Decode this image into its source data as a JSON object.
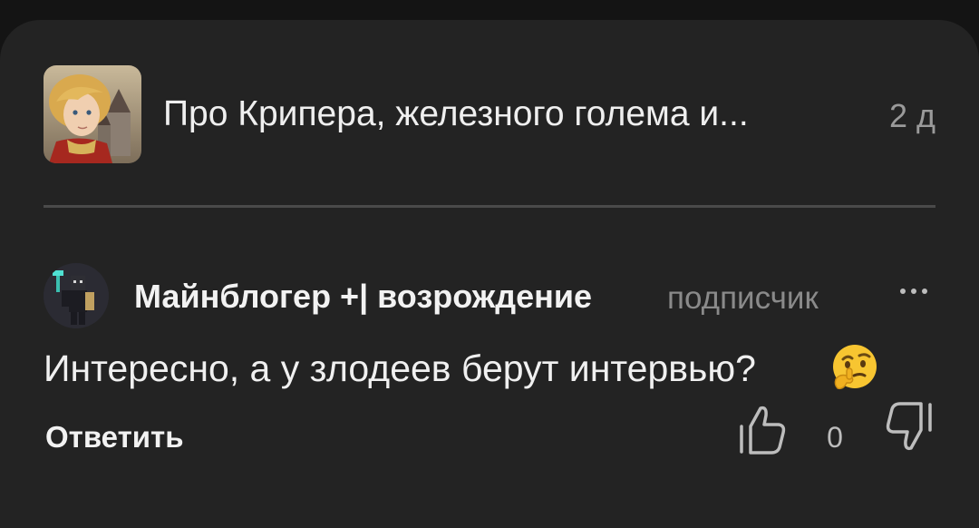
{
  "post": {
    "title": "Про Крипера, железного голема и...",
    "time": "2 д",
    "thumbnail_icon": "anime-prince-castle-icon"
  },
  "comment": {
    "author": "Майнблогер +| возрождение",
    "role": "подписчик",
    "text": "Интересно, а у злодеев берут интервью?",
    "emoji_icon": "thinking-face-emoji",
    "avatar_icon": "minecraft-character-icon",
    "more_icon": "more-horizontal-icon"
  },
  "actions": {
    "reply_label": "Ответить",
    "like_icon": "thumbs-up-icon",
    "like_count": "0",
    "dislike_icon": "thumbs-down-icon"
  },
  "colors": {
    "background": "#232323",
    "text_primary": "#f0f0f0",
    "text_secondary": "#8a8a8a",
    "divider": "#4a4a4a"
  }
}
